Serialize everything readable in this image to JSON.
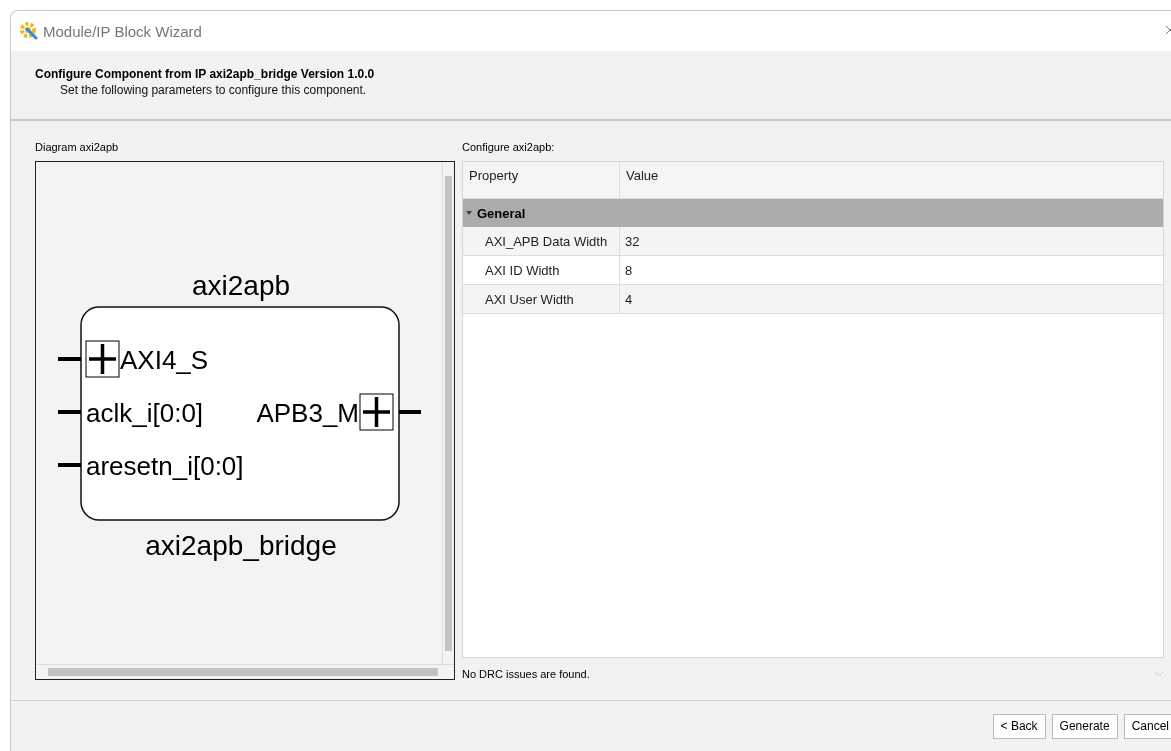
{
  "window": {
    "title": "Module/IP Block Wizard"
  },
  "header": {
    "title": "Configure Component from IP axi2apb_bridge Version 1.0.0",
    "subtitle": "Set the following parameters to configure this component."
  },
  "diagram": {
    "label": "Diagram axi2apb",
    "instance_name": "axi2apb",
    "module_name": "axi2apb_bridge",
    "left_ports": [
      {
        "name": "AXI4_S",
        "kind": "bus"
      },
      {
        "name": "aclk_i[0:0]",
        "kind": "wire"
      },
      {
        "name": "aresetn_i[0:0]",
        "kind": "wire"
      }
    ],
    "right_ports": [
      {
        "name": "APB3_M",
        "kind": "bus"
      }
    ]
  },
  "config": {
    "label": "Configure axi2apb:",
    "columns": [
      "Property",
      "Value"
    ],
    "groups": [
      {
        "name": "General",
        "expanded": true,
        "rows": [
          {
            "property": "AXI_APB Data Width",
            "value": "32"
          },
          {
            "property": "AXI ID Width",
            "value": "8"
          },
          {
            "property": "AXI User Width",
            "value": "4"
          }
        ]
      }
    ],
    "status": "No DRC issues are found."
  },
  "buttons": [
    "< Back",
    "Generate",
    "Cancel"
  ]
}
